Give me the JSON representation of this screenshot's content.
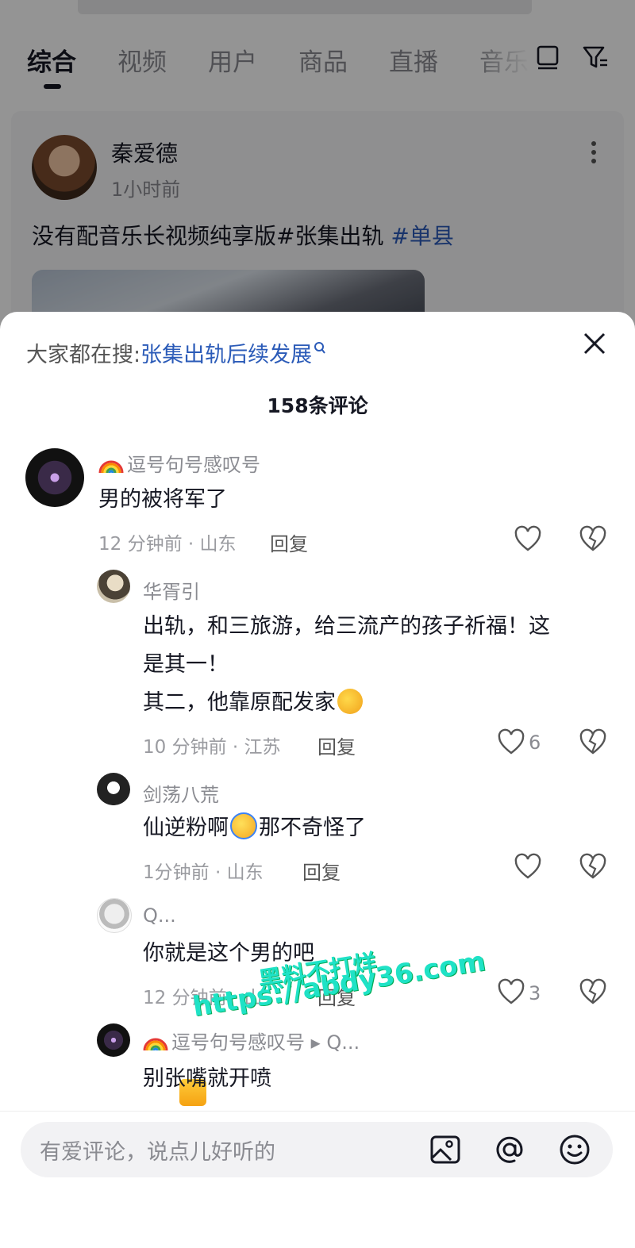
{
  "tabs": [
    "综合",
    "视频",
    "用户",
    "商品",
    "直播",
    "音乐"
  ],
  "post": {
    "author": "秦爱德",
    "time": "1小时前",
    "text": "没有配音乐长视频纯享版#张集出轨",
    "tag": "#单县"
  },
  "sheet": {
    "search_prefix": "大家都在搜:",
    "search_query": "张集出轨后续发展",
    "comment_count": "158条评论"
  },
  "comments": [
    {
      "name": "逗号句号感叹号",
      "text": "男的被将军了",
      "meta": "12 分钟前 · 山东",
      "reply": "回复",
      "likes": ""
    },
    {
      "name": "华胥引",
      "text1": "出轨，和三旅游，给三流产的孩子祈福！这",
      "text2": "是其一！",
      "text3": "其二，他靠原配发家",
      "meta": "10 分钟前 · 江苏",
      "reply": "回复",
      "likes": "6"
    },
    {
      "name": "剑荡八荒",
      "text_a": "仙逆粉啊",
      "text_b": "那不奇怪了",
      "meta": "1分钟前 · 山东",
      "reply": "回复",
      "likes": ""
    },
    {
      "name": "Q...",
      "text": "你就是这个男的吧",
      "meta": "12 分钟前 · 山",
      "reply": "回复",
      "likes": "3"
    },
    {
      "name": "逗号句号感叹号",
      "reply_to": "▸ Q...",
      "text": "别张嘴就开喷"
    }
  ],
  "watermark": {
    "line1": "黑料不打烊",
    "line2": "https://abdy36.com"
  },
  "input": {
    "placeholder": "有爱评论，说点儿好听的"
  },
  "icons": [
    "list-icon",
    "filter-icon",
    "more-icon",
    "close-icon",
    "search-icon",
    "heart-icon",
    "broken-heart-icon",
    "image-icon",
    "at-icon",
    "emoji-icon"
  ]
}
